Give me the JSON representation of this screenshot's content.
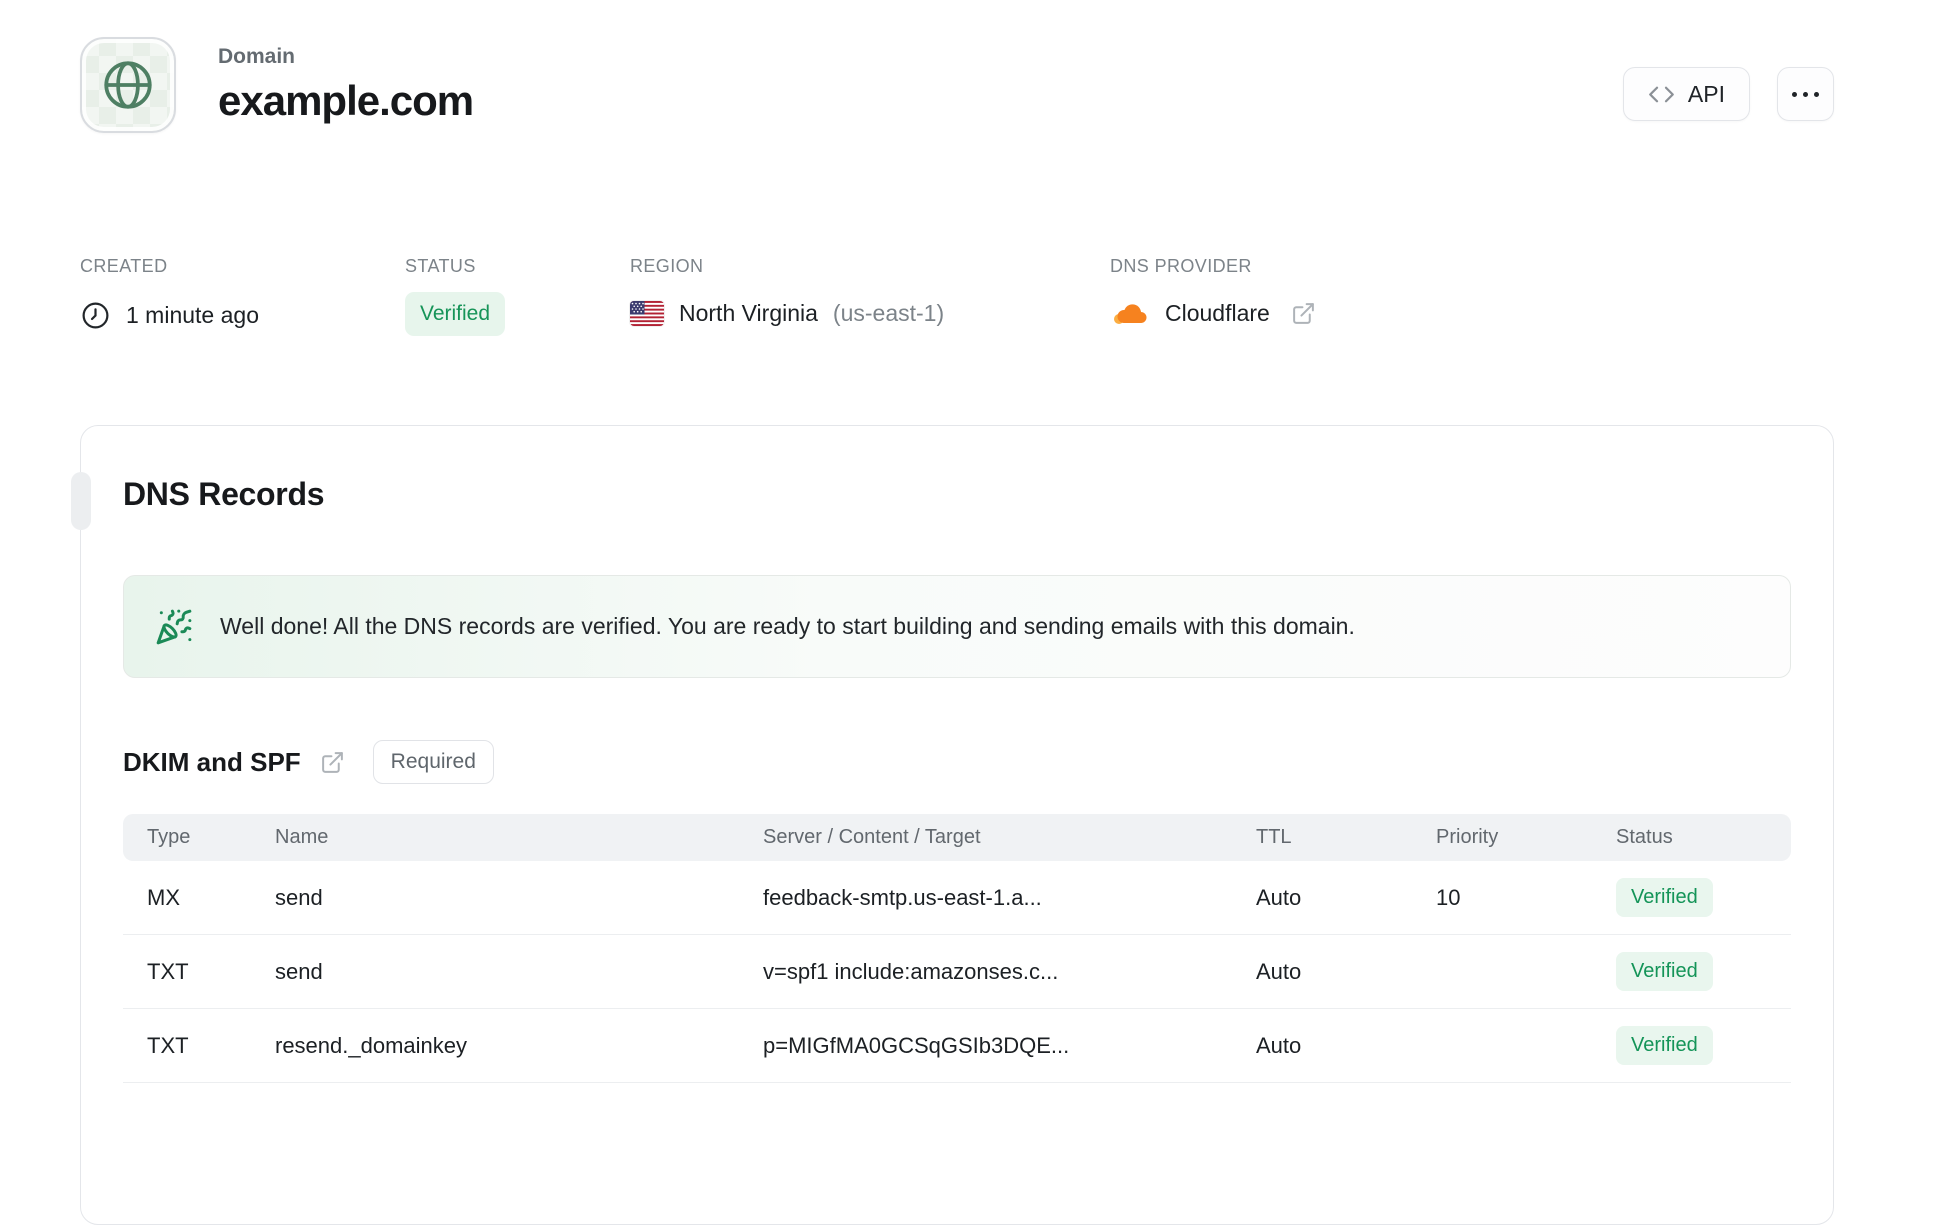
{
  "header": {
    "eyebrow": "Domain",
    "title": "example.com",
    "api_button": "API"
  },
  "meta": {
    "created": {
      "label": "CREATED",
      "value": "1 minute ago"
    },
    "status": {
      "label": "STATUS",
      "value": "Verified"
    },
    "region": {
      "label": "REGION",
      "value": "North Virginia",
      "code": "(us-east-1)"
    },
    "dns_provider": {
      "label": "DNS PROVIDER",
      "value": "Cloudflare"
    }
  },
  "dns_card": {
    "title": "DNS Records",
    "banner": "Well done! All the DNS records are verified. You are ready to start building and sending emails with this domain.",
    "section": {
      "title": "DKIM and SPF",
      "badge": "Required"
    },
    "table": {
      "headers": [
        "Type",
        "Name",
        "Server / Content / Target",
        "TTL",
        "Priority",
        "Status"
      ],
      "rows": [
        {
          "type": "MX",
          "name": "send",
          "content": "feedback-smtp.us-east-1.a...",
          "ttl": "Auto",
          "priority": "10",
          "status": "Verified"
        },
        {
          "type": "TXT",
          "name": "send",
          "content": "v=spf1 include:amazonses.c...",
          "ttl": "Auto",
          "priority": "",
          "status": "Verified"
        },
        {
          "type": "TXT",
          "name": "resend._domainkey",
          "content": "p=MIGfMA0GCSqGSIb3DQE...",
          "ttl": "Auto",
          "priority": "",
          "status": "Verified"
        }
      ]
    }
  },
  "colors": {
    "accent_green": "#169458",
    "badge_green_bg": "#e9f6ee",
    "cloudflare_orange": "#f6821f",
    "border": "#e4e6ea"
  }
}
